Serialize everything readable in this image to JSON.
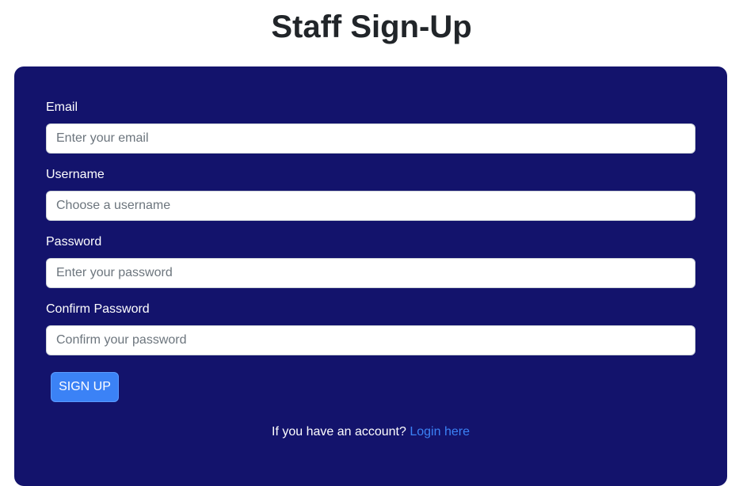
{
  "page": {
    "title": "Staff Sign-Up"
  },
  "form": {
    "email": {
      "label": "Email",
      "placeholder": "Enter your email",
      "value": ""
    },
    "username": {
      "label": "Username",
      "placeholder": "Choose a username",
      "value": ""
    },
    "password": {
      "label": "Password",
      "placeholder": "Enter your password",
      "value": ""
    },
    "confirm_password": {
      "label": "Confirm Password",
      "placeholder": "Confirm your password",
      "value": ""
    },
    "submit_label": "SIGN UP"
  },
  "footer": {
    "prompt": "If you have an account?",
    "login_link": "Login here"
  },
  "colors": {
    "card_background": "#13136c",
    "button": "#3b82f6",
    "link": "#3b82f6"
  }
}
